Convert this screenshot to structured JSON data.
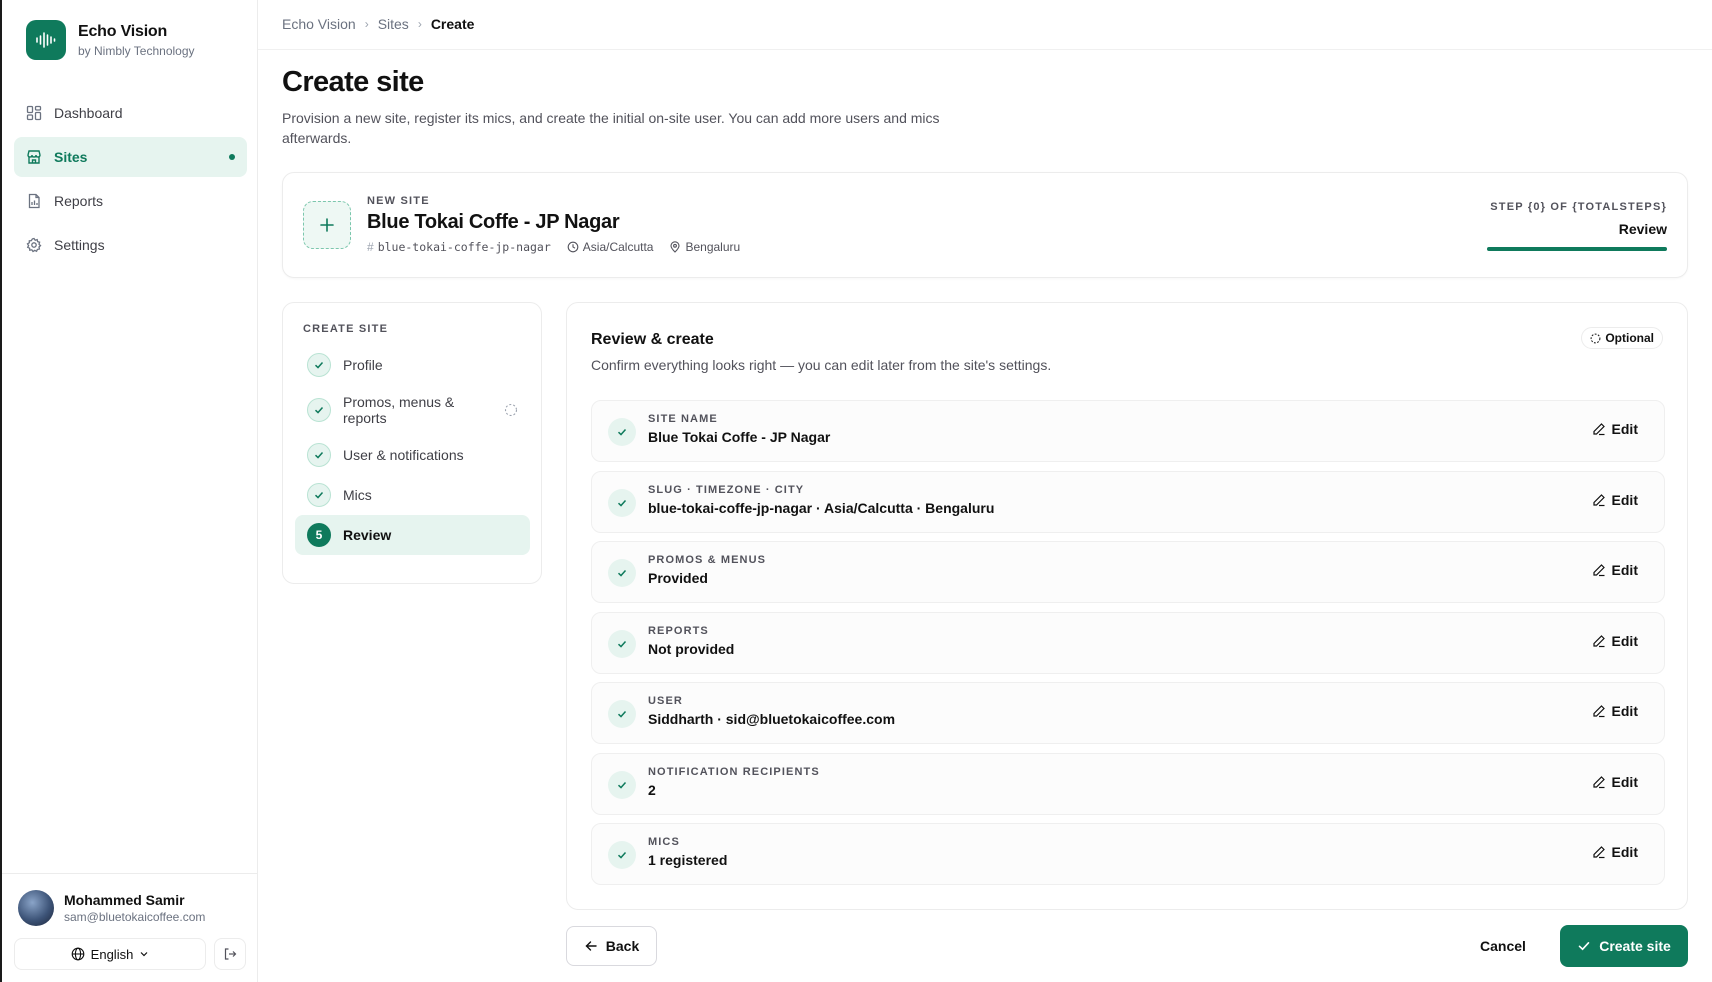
{
  "app": {
    "name": "Echo Vision",
    "subtitle": "by Nimbly Technology"
  },
  "sidebar": {
    "items": [
      {
        "label": "Dashboard",
        "icon": "grid-icon",
        "active": false
      },
      {
        "label": "Sites",
        "icon": "store-icon",
        "active": true
      },
      {
        "label": "Reports",
        "icon": "file-icon",
        "active": false
      },
      {
        "label": "Settings",
        "icon": "gear-icon",
        "active": false
      }
    ],
    "user": {
      "name": "Mohammed Samir",
      "email": "sam@bluetokaicoffee.com"
    },
    "language": "English"
  },
  "breadcrumb": [
    "Echo Vision",
    "Sites",
    "Create"
  ],
  "page": {
    "title": "Create site",
    "description": "Provision a new site, register its mics, and create the initial on-site user. You can add more users and mics afterwards."
  },
  "site_card": {
    "eyebrow": "NEW SITE",
    "name": "Blue Tokai Coffe - JP Nagar",
    "slug": "blue-tokai-coffe-jp-nagar",
    "timezone": "Asia/Calcutta",
    "city": "Bengaluru",
    "step_label": "STEP {0} OF {TOTALSTEPS}",
    "step_name": "Review",
    "progress": 1.0
  },
  "steps": {
    "title": "CREATE SITE",
    "items": [
      {
        "label": "Profile",
        "state": "done"
      },
      {
        "label": "Promos, menus & reports",
        "state": "done",
        "optional": true
      },
      {
        "label": "User & notifications",
        "state": "done"
      },
      {
        "label": "Mics",
        "state": "done"
      },
      {
        "label": "Review",
        "state": "active",
        "number": "5"
      }
    ]
  },
  "review": {
    "title": "Review & create",
    "description": "Confirm everything looks right — you can edit later from the site's settings.",
    "badge": "Optional",
    "edit_label": "Edit",
    "rows": [
      {
        "label": "SITE NAME",
        "value": "Blue Tokai Coffe - JP Nagar"
      },
      {
        "label": "SLUG · TIMEZONE · CITY",
        "value": "blue-tokai-coffe-jp-nagar · Asia/Calcutta · Bengaluru"
      },
      {
        "label": "PROMOS & MENUS",
        "value": "Provided"
      },
      {
        "label": "REPORTS",
        "value": "Not provided"
      },
      {
        "label": "USER",
        "value": "Siddharth · sid@bluetokaicoffee.com"
      },
      {
        "label": "NOTIFICATION RECIPIENTS",
        "value": "2"
      },
      {
        "label": "MICS",
        "value": "1 registered"
      }
    ]
  },
  "actions": {
    "back": "Back",
    "cancel": "Cancel",
    "create": "Create site"
  },
  "colors": {
    "brand": "#0f7a5c",
    "brand_tint": "#e6f4ef"
  }
}
